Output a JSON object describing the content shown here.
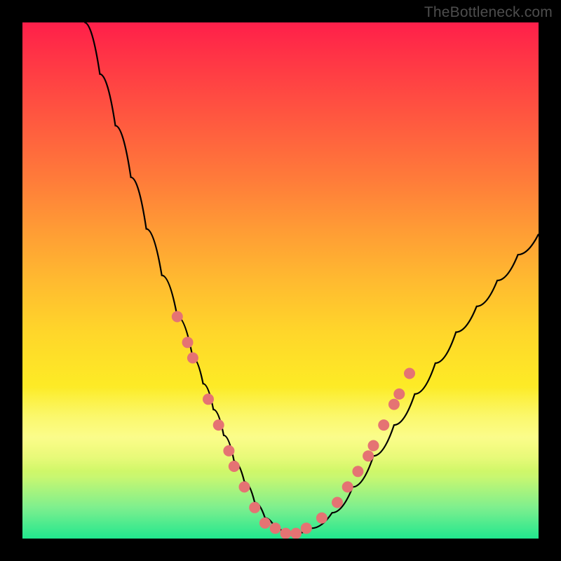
{
  "watermark": "TheBottleneck.com",
  "colors": {
    "curve_stroke": "#000000",
    "dot_fill": "#e57373",
    "dot_stroke": "#c95f5f"
  },
  "chart_data": {
    "type": "line",
    "title": "",
    "xlabel": "",
    "ylabel": "",
    "xlim": [
      0,
      100
    ],
    "ylim": [
      0,
      100
    ],
    "grid": false,
    "series": [
      {
        "name": "bottleneck-curve",
        "x": [
          12,
          15,
          18,
          21,
          24,
          27,
          30,
          33,
          35,
          37,
          39,
          41,
          43,
          45,
          47,
          49,
          51,
          53,
          56,
          60,
          64,
          68,
          72,
          76,
          80,
          84,
          88,
          92,
          96,
          100
        ],
        "y": [
          100,
          90,
          80,
          70,
          60,
          51,
          43,
          35,
          30,
          25,
          20,
          15,
          11,
          7,
          4,
          2,
          1,
          1,
          2,
          5,
          10,
          16,
          22,
          28,
          34,
          40,
          45,
          50,
          55,
          59
        ]
      }
    ],
    "markers": [
      {
        "name": "left-dot-1",
        "x": 30,
        "y": 43
      },
      {
        "name": "left-dot-2",
        "x": 32,
        "y": 38
      },
      {
        "name": "left-dot-3",
        "x": 33,
        "y": 35
      },
      {
        "name": "left-dot-4",
        "x": 36,
        "y": 27
      },
      {
        "name": "left-dot-5",
        "x": 38,
        "y": 22
      },
      {
        "name": "left-dot-6",
        "x": 40,
        "y": 17
      },
      {
        "name": "left-dot-7",
        "x": 41,
        "y": 14
      },
      {
        "name": "left-dot-8",
        "x": 43,
        "y": 10
      },
      {
        "name": "left-dot-9",
        "x": 45,
        "y": 6
      },
      {
        "name": "bottom-dot-1",
        "x": 47,
        "y": 3
      },
      {
        "name": "bottom-dot-2",
        "x": 49,
        "y": 2
      },
      {
        "name": "bottom-dot-3",
        "x": 51,
        "y": 1
      },
      {
        "name": "bottom-dot-4",
        "x": 53,
        "y": 1
      },
      {
        "name": "bottom-dot-5",
        "x": 55,
        "y": 2
      },
      {
        "name": "right-dot-1",
        "x": 58,
        "y": 4
      },
      {
        "name": "right-dot-2",
        "x": 61,
        "y": 7
      },
      {
        "name": "right-dot-3",
        "x": 63,
        "y": 10
      },
      {
        "name": "right-dot-4",
        "x": 65,
        "y": 13
      },
      {
        "name": "right-dot-5",
        "x": 67,
        "y": 16
      },
      {
        "name": "right-dot-6",
        "x": 68,
        "y": 18
      },
      {
        "name": "right-dot-7",
        "x": 70,
        "y": 22
      },
      {
        "name": "right-dot-8",
        "x": 72,
        "y": 26
      },
      {
        "name": "right-dot-9",
        "x": 73,
        "y": 28
      },
      {
        "name": "right-dot-10",
        "x": 75,
        "y": 32
      }
    ]
  }
}
